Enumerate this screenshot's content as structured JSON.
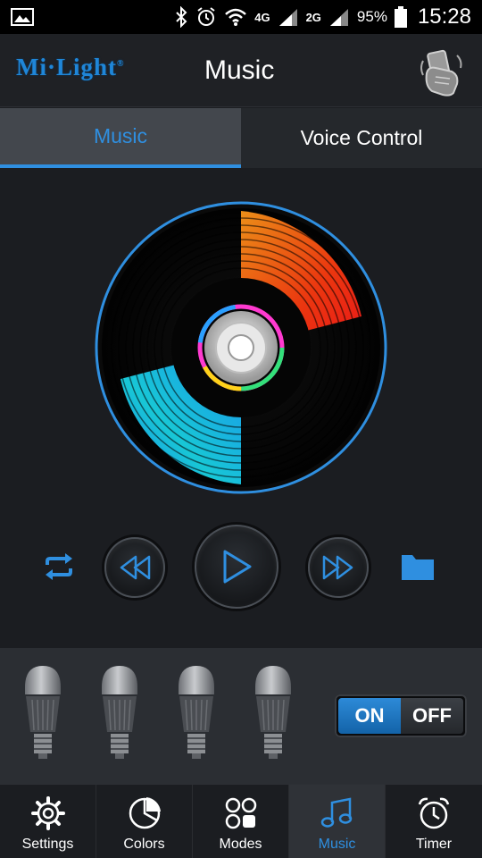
{
  "status_bar": {
    "network_4g": "4G",
    "network_4g_small": "4G",
    "network_2g": "2G",
    "battery": "95%",
    "time": "15:28"
  },
  "header": {
    "logo": "Mi·Light",
    "logo_mark": "®",
    "title": "Music"
  },
  "tabs": [
    {
      "label": "Music",
      "active": true
    },
    {
      "label": "Voice Control",
      "active": false
    }
  ],
  "player": {
    "icons": [
      "repeat-icon",
      "rewind-icon",
      "play-icon",
      "fast-forward-icon",
      "folder-icon"
    ]
  },
  "bulbs": {
    "count": 4,
    "switch": {
      "on_label": "ON",
      "off_label": "OFF",
      "state": "on"
    }
  },
  "bottom_nav": [
    {
      "label": "Settings",
      "icon": "gear-icon",
      "active": false
    },
    {
      "label": "Colors",
      "icon": "pie-chart-icon",
      "active": false
    },
    {
      "label": "Modes",
      "icon": "modes-grid-icon",
      "active": false
    },
    {
      "label": "Music",
      "icon": "music-note-icon",
      "active": true
    },
    {
      "label": "Timer",
      "icon": "alarm-clock-icon",
      "active": false
    }
  ],
  "colors": {
    "accent": "#2f8fe0",
    "background": "#1b1d21",
    "status_bar": "#000000"
  }
}
